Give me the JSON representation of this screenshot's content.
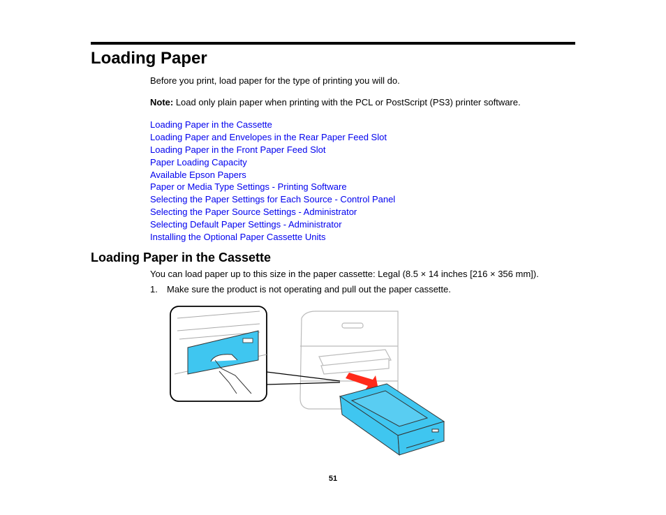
{
  "page": {
    "title": "Loading Paper",
    "intro": "Before you print, load paper for the type of printing you will do.",
    "note_label": "Note:",
    "note_text": " Load only plain paper when printing with the PCL or PostScript (PS3) printer software.",
    "links": [
      "Loading Paper in the Cassette",
      "Loading Paper and Envelopes in the Rear Paper Feed Slot",
      "Loading Paper in the Front Paper Feed Slot",
      "Paper Loading Capacity",
      "Available Epson Papers",
      "Paper or Media Type Settings - Printing Software",
      "Selecting the Paper Settings for Each Source - Control Panel",
      "Selecting the Paper Source Settings - Administrator",
      "Selecting Default Paper Settings - Administrator",
      "Installing the Optional Paper Cassette Units"
    ],
    "link_color": "#0000ee"
  },
  "section": {
    "title": "Loading Paper in the Cassette",
    "body": "You can load paper up to this size in the paper cassette: Legal (8.5 × 14 inches [216 × 356 mm]).",
    "steps": [
      {
        "number": "1.",
        "text": "Make sure the product is not operating and pull out the paper cassette."
      }
    ]
  },
  "figure": {
    "description": "Illustration of pulling the paper cassette out of the printer",
    "cassette_color": "#3fc6f0",
    "arrow_color": "#ff2a1a"
  },
  "footer": {
    "page_number": "51"
  }
}
